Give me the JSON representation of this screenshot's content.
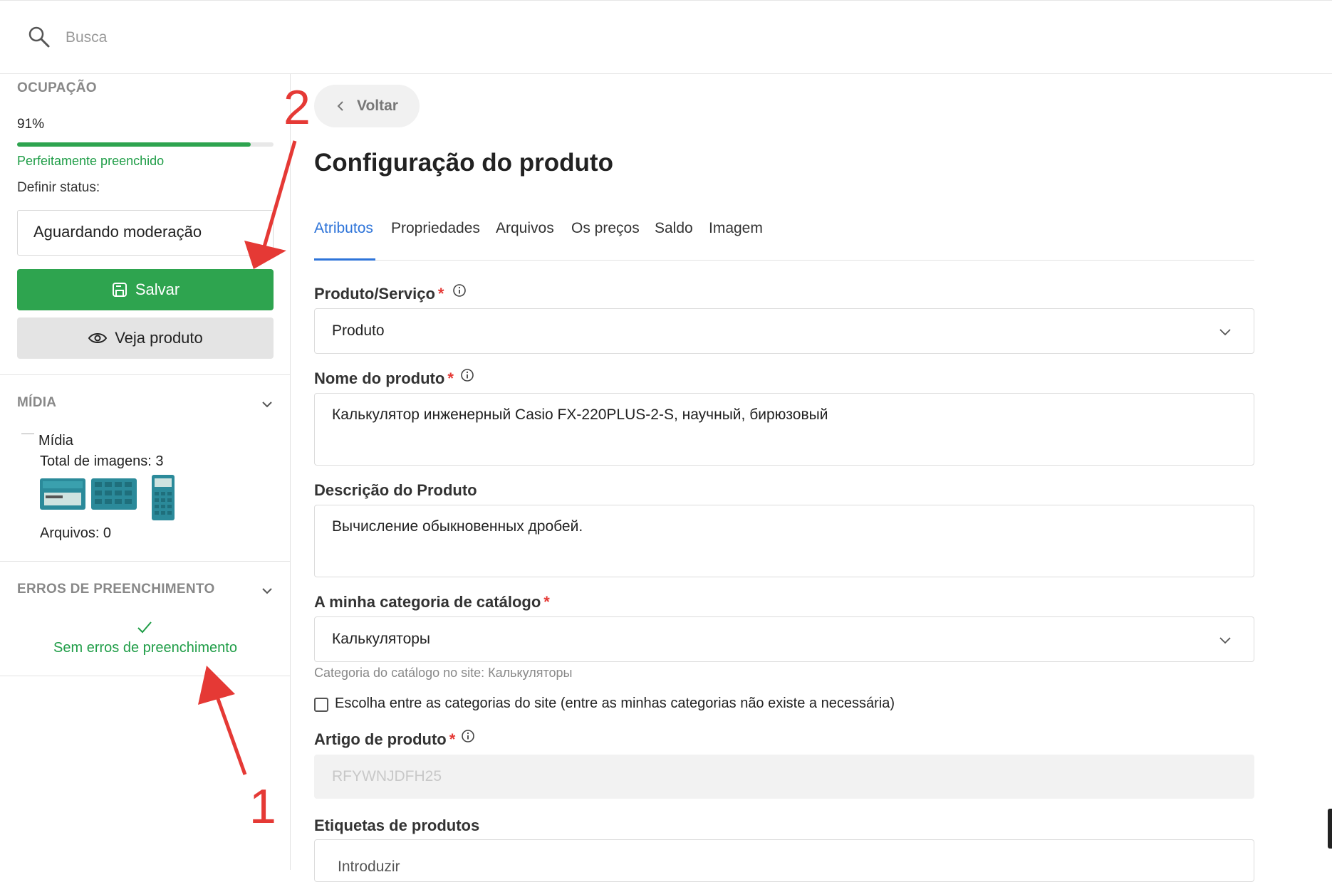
{
  "search": {
    "placeholder": "Busca"
  },
  "sidebar": {
    "occupancy": {
      "title": "OCUPAÇÃO",
      "percent_text": "91%",
      "progress": 0.91,
      "status_text": "Perfeitamente preenchido"
    },
    "set_status_label": "Definir status:",
    "status_value": "Aguardando moderação",
    "save_label": "Salvar",
    "view_product_label": "Veja produto",
    "media": {
      "title": "MÍDIA",
      "name": "Mídia",
      "total_images": "Total de imagens: 3",
      "files": "Arquivos: 0"
    },
    "errors": {
      "title": "ERROS DE PREENCHIMENTO",
      "message": "Sem erros de preenchimento"
    }
  },
  "main": {
    "back_label": "Voltar",
    "title": "Configuração do produto",
    "tabs": [
      {
        "label": "Atributos",
        "active": true
      },
      {
        "label": "Propriedades",
        "active": false
      },
      {
        "label": "Arquivos",
        "active": false
      },
      {
        "label": "Os preços",
        "active": false
      },
      {
        "label": "Saldo",
        "active": false
      },
      {
        "label": "Imagem",
        "active": false
      }
    ],
    "fields": {
      "type": {
        "label": "Produto/Serviço",
        "value": "Produto"
      },
      "name": {
        "label": "Nome do produto",
        "value": "Калькулятор инженерный Casio FX-220PLUS-2-S, научный, бирюзовый"
      },
      "description": {
        "label": "Descrição do Produto",
        "value": "Вычисление обыкновенных дробей."
      },
      "category": {
        "label": "A minha categoria de catálogo",
        "value": "Калькуляторы",
        "hint": "Categoria do catálogo no site: Калькуляторы"
      },
      "site_category_checkbox": {
        "label": "Escolha entre as categorias do site (entre as minhas categorias não existe a necessária)",
        "checked": false
      },
      "sku": {
        "label": "Artigo de produto",
        "value": "RFYWNJDFH25"
      },
      "tags": {
        "label": "Etiquetas de produtos",
        "placeholder": "Introduzir"
      }
    },
    "required_mark": "*"
  },
  "annotations": [
    {
      "number": "1",
      "color": "#e53935"
    },
    {
      "number": "2",
      "color": "#e53935"
    }
  ],
  "colors": {
    "accent_green": "#2ea44f",
    "tab_blue": "#2e74d9",
    "required_red": "#e53935"
  }
}
